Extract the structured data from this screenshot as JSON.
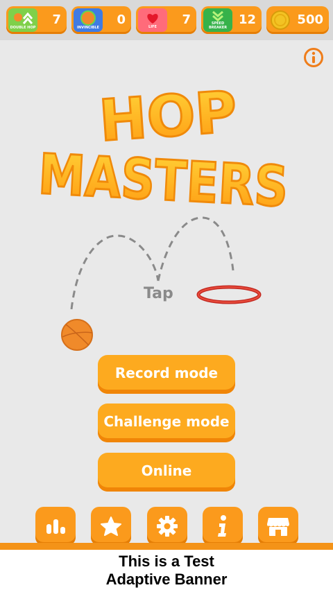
{
  "powerups": [
    {
      "name": "double-hop",
      "caption": "DOUBLE HOP",
      "count": "7",
      "tile_color": "#7fd04a"
    },
    {
      "name": "invincible",
      "caption": "INVINCIBLE",
      "count": "0",
      "tile_color": "#3f7be3"
    },
    {
      "name": "life",
      "caption": "LIFE",
      "count": "7",
      "tile_color": "#ff6b7a"
    },
    {
      "name": "speed-breaker",
      "caption": "SPEED BREAKER",
      "count": "12",
      "tile_color": "#36b24a"
    }
  ],
  "coins": {
    "count": "500",
    "icon": "coin-icon"
  },
  "title": {
    "line1": "HOP",
    "line2": "MASTERS"
  },
  "tap_hint": "Tap",
  "buttons": {
    "record": "Record mode",
    "challenge": "Challenge mode",
    "online": "Online"
  },
  "bottom_icons": [
    "leaderboard-icon",
    "star-icon",
    "gear-icon",
    "info-icon",
    "shop-icon"
  ],
  "banner": {
    "line1": "This is a Test",
    "line2": "Adaptive Banner"
  },
  "colors": {
    "accent": "#fb9a1c",
    "background": "#e9e9e9",
    "hoop": "#d9342b",
    "ball": "#f08a2a"
  }
}
